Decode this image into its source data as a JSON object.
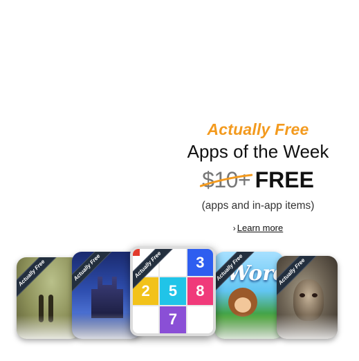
{
  "promo": {
    "tagline": "Actually Free",
    "title": "Apps of the Week",
    "old_price": "$10+",
    "new_price": "FREE",
    "subtitle": "(apps and in-app items)",
    "learn_more": "Learn more",
    "learn_more_chevron": "›"
  },
  "carousel": {
    "ribbon_label": "Actually Free",
    "featured_grid": [
      "",
      "",
      "3",
      "2",
      "5",
      "8",
      "",
      "7",
      ""
    ],
    "word_game_title": "Word"
  },
  "colors": {
    "accent": "#f39a1e",
    "ribbon": "#232f3e"
  }
}
